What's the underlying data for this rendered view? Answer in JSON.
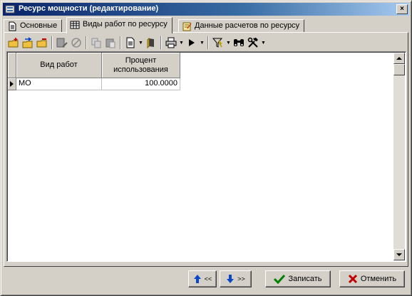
{
  "window": {
    "title": "Ресурс мощности (редактирование)",
    "close_label": "×"
  },
  "tabs": [
    {
      "label": "Основные",
      "icon": "document-icon",
      "active": false
    },
    {
      "label": "Виды работ по ресурсу",
      "icon": "table-icon",
      "active": true
    },
    {
      "label": "Данные расчетов по ресурсу",
      "icon": "notebook-icon",
      "active": false
    }
  ],
  "toolbar": {
    "items": [
      "add-record-icon",
      "add-copy-icon",
      "delete-record-icon",
      "edit-icon",
      "cancel-icon",
      "copy-icon",
      "paste-icon",
      "document-icon",
      "report-icon",
      "print-icon",
      "run-icon",
      "filter-icon",
      "find-icon",
      "tools-icon"
    ]
  },
  "grid": {
    "columns": [
      "Вид работ",
      "Процент использования"
    ],
    "rows": [
      {
        "work_type": "МО",
        "percent": "100.0000",
        "current": true
      }
    ]
  },
  "buttons": {
    "prev_label": "<<",
    "next_label": ">>",
    "save_label": "Записать",
    "cancel_label": "Отменить"
  },
  "colors": {
    "title_bar": "#0a246a",
    "face": "#d4d0c8",
    "save_check": "#008000",
    "cancel_x": "#c00000",
    "nav_arrow": "#0a46c8"
  }
}
